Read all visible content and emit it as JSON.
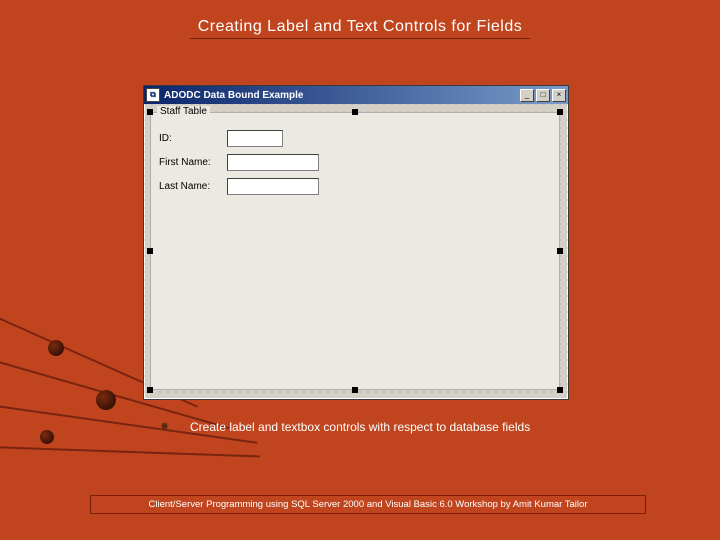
{
  "slide": {
    "title": "Creating Label and Text Controls for Fields",
    "bullet_icon": "✸",
    "bullet_text": "Create label and textbox controls with respect to database fields",
    "footer": "Client/Server Programming using SQL Server 2000 and Visual Basic 6.0 Workshop by Amit Kumar Tailor"
  },
  "window": {
    "title": "ADODC Data Bound Example",
    "min": "_",
    "max": "□",
    "close": "×",
    "frame_caption": "Staff Table",
    "fields": [
      {
        "label": "ID:",
        "value": ""
      },
      {
        "label": "First Name:",
        "value": ""
      },
      {
        "label": "Last Name:",
        "value": ""
      }
    ]
  }
}
